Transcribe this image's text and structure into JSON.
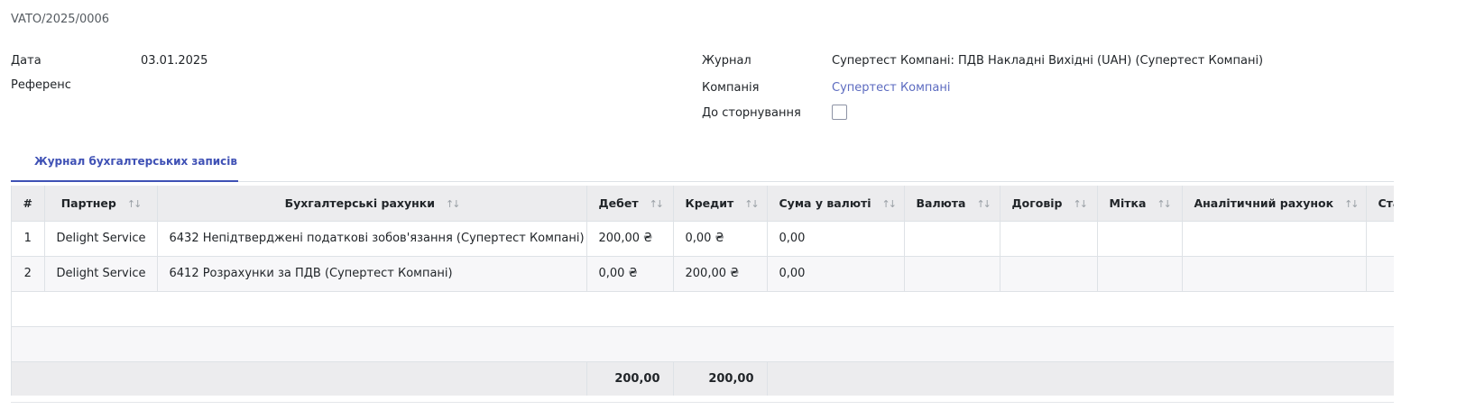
{
  "document": {
    "name": "VATO/2025/0006"
  },
  "fields": {
    "date_label": "Дата",
    "date_value": "03.01.2025",
    "reference_label": "Референс",
    "journal_label": "Журнал",
    "journal_value": "Супертест Компані: ПДВ Накладні Вихідні (UAH) (Супертест Компані)",
    "company_label": "Компанія",
    "company_value": "Супертест Компані",
    "reversal_label": "До сторнування",
    "reversal_checked": false
  },
  "tabs": [
    {
      "label": "Журнал бухгалтерських записів",
      "active": true
    }
  ],
  "table": {
    "columns": {
      "num": "#",
      "partner": "Партнер",
      "account": "Бухгалтерські рахунки",
      "debit": "Дебет",
      "credit": "Кредит",
      "amount_currency": "Сума у валюті",
      "currency": "Валюта",
      "contract": "Договір",
      "tag": "Мітка",
      "analytic": "Аналітичний рахунок",
      "status_partial": "Ста"
    },
    "rows": [
      {
        "num": "1",
        "partner": "Delight Service",
        "account": "6432 Непідтверджені податкові зобов'язання (Супертест Компані)",
        "debit": "200,00 ₴",
        "credit": "0,00 ₴",
        "amount_currency": "0,00"
      },
      {
        "num": "2",
        "partner": "Delight Service",
        "account": "6412 Розрахунки за ПДВ (Супертест Компані)",
        "debit": "0,00 ₴",
        "credit": "200,00 ₴",
        "amount_currency": "0,00"
      }
    ],
    "totals": {
      "debit": "200,00",
      "credit": "200,00"
    }
  },
  "icons": {
    "sort": "sort-arrows-icon"
  }
}
